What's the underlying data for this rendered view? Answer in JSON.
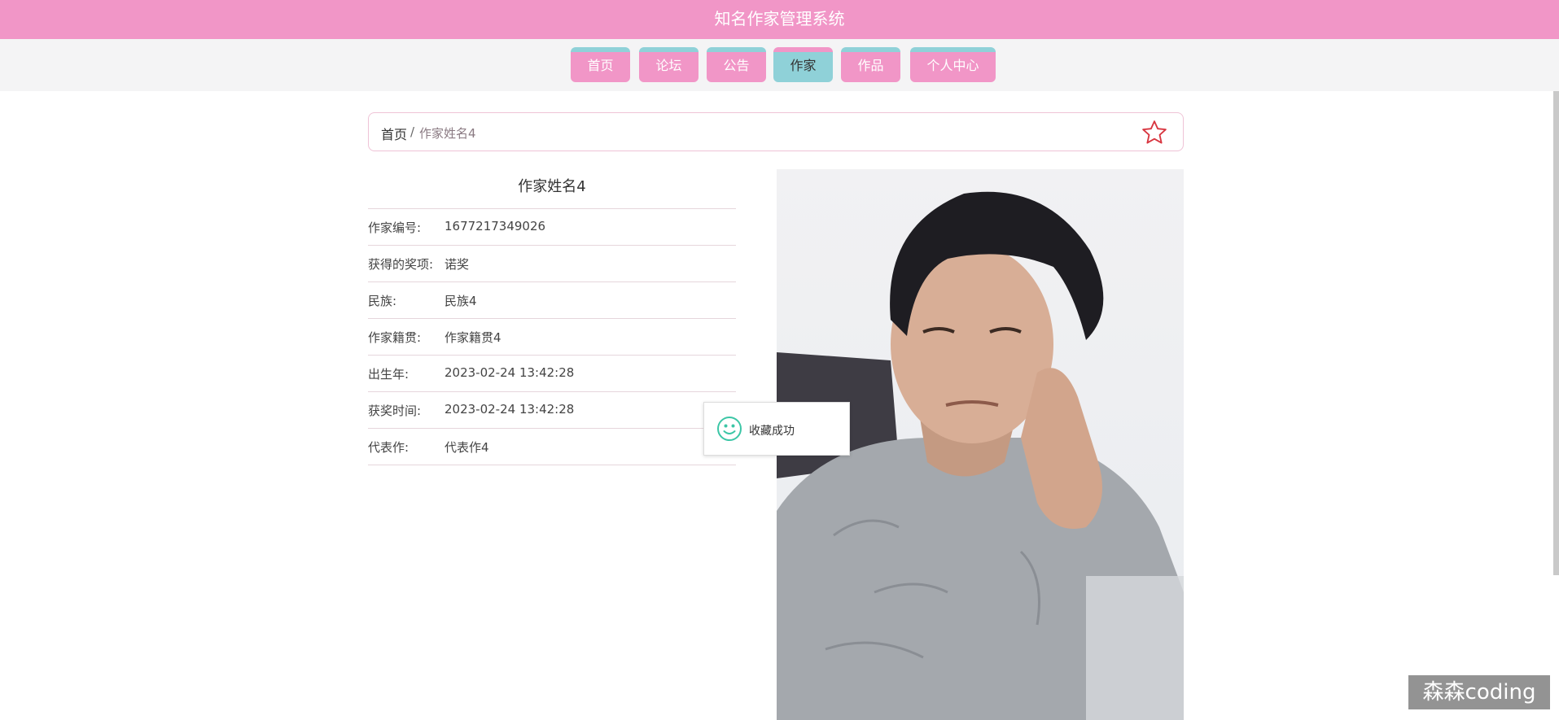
{
  "header": {
    "title": "知名作家管理系统"
  },
  "nav": {
    "items": [
      {
        "label": "首页"
      },
      {
        "label": "论坛"
      },
      {
        "label": "公告"
      },
      {
        "label": "作家",
        "active": true
      },
      {
        "label": "作品"
      },
      {
        "label": "个人中心"
      }
    ]
  },
  "breadcrumb": {
    "home": "首页",
    "separator": "/",
    "current": "作家姓名4",
    "favorite_icon": "star-outline-icon"
  },
  "writer": {
    "name": "作家姓名4",
    "fields": [
      {
        "label": "作家编号:",
        "value": "1677217349026"
      },
      {
        "label": "获得的奖项:",
        "value": "诺奖"
      },
      {
        "label": "民族:",
        "value": "民族4"
      },
      {
        "label": "作家籍贯:",
        "value": "作家籍贯4"
      },
      {
        "label": "出生年:",
        "value": "2023-02-24 13:42:28"
      },
      {
        "label": "获奖时间:",
        "value": "2023-02-24 13:42:28"
      },
      {
        "label": "代表作:",
        "value": "代表作4"
      }
    ]
  },
  "toast": {
    "icon": "smiley-icon",
    "text": "收藏成功"
  },
  "watermark": {
    "text": "森森coding"
  },
  "colors": {
    "brand_pink": "#f196c7",
    "accent_teal": "#8fd1d8",
    "star_red": "#d8353f",
    "toast_green": "#3cc6a6"
  }
}
